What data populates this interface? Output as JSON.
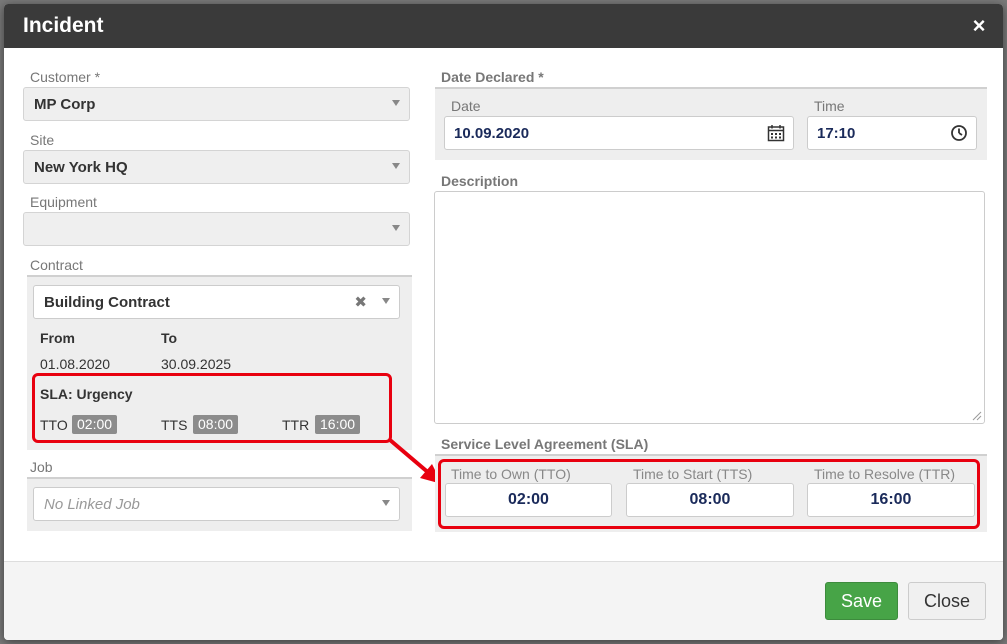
{
  "modal": {
    "title": "Incident",
    "close_glyph": "×"
  },
  "left": {
    "customer": {
      "label": "Customer *",
      "value": "MP Corp"
    },
    "site": {
      "label": "Site",
      "value": "New York HQ"
    },
    "equipment": {
      "label": "Equipment",
      "value": ""
    },
    "contract": {
      "label": "Contract",
      "value": "Building Contract",
      "clear_glyph": "✖",
      "from_label": "From",
      "to_label": "To",
      "from_value": "01.08.2020",
      "to_value": "30.09.2025",
      "sla_title": "SLA: Urgency",
      "tto_label": "TTO",
      "tto_value": "02:00",
      "tts_label": "TTS",
      "tts_value": "08:00",
      "ttr_label": "TTR",
      "ttr_value": "16:00"
    },
    "job": {
      "label": "Job",
      "placeholder": "No Linked Job"
    }
  },
  "right": {
    "date_declared_label": "Date Declared *",
    "date_label": "Date",
    "date_value": "10.09.2020",
    "time_label": "Time",
    "time_value": "17:10",
    "description_label": "Description",
    "description_value": "",
    "sla": {
      "label": "Service Level Agreement (SLA)",
      "tto_label": "Time to Own (TTO)",
      "tto_value": "02:00",
      "tts_label": "Time to Start (TTS)",
      "tts_value": "08:00",
      "ttr_label": "Time to Resolve (TTR)",
      "ttr_value": "16:00"
    }
  },
  "footer": {
    "save_label": "Save",
    "close_label": "Close"
  },
  "colors": {
    "header_bg": "#3a3a3a",
    "highlight_red": "#e8000f",
    "save_green": "#47a447",
    "badge_gray": "#8c8c8c"
  },
  "icons": {
    "close": "close-icon",
    "calendar": "calendar-icon",
    "clock": "clock-icon",
    "caret": "chevron-down-icon",
    "clear": "clear-icon",
    "arrow": "annotation-arrow"
  }
}
